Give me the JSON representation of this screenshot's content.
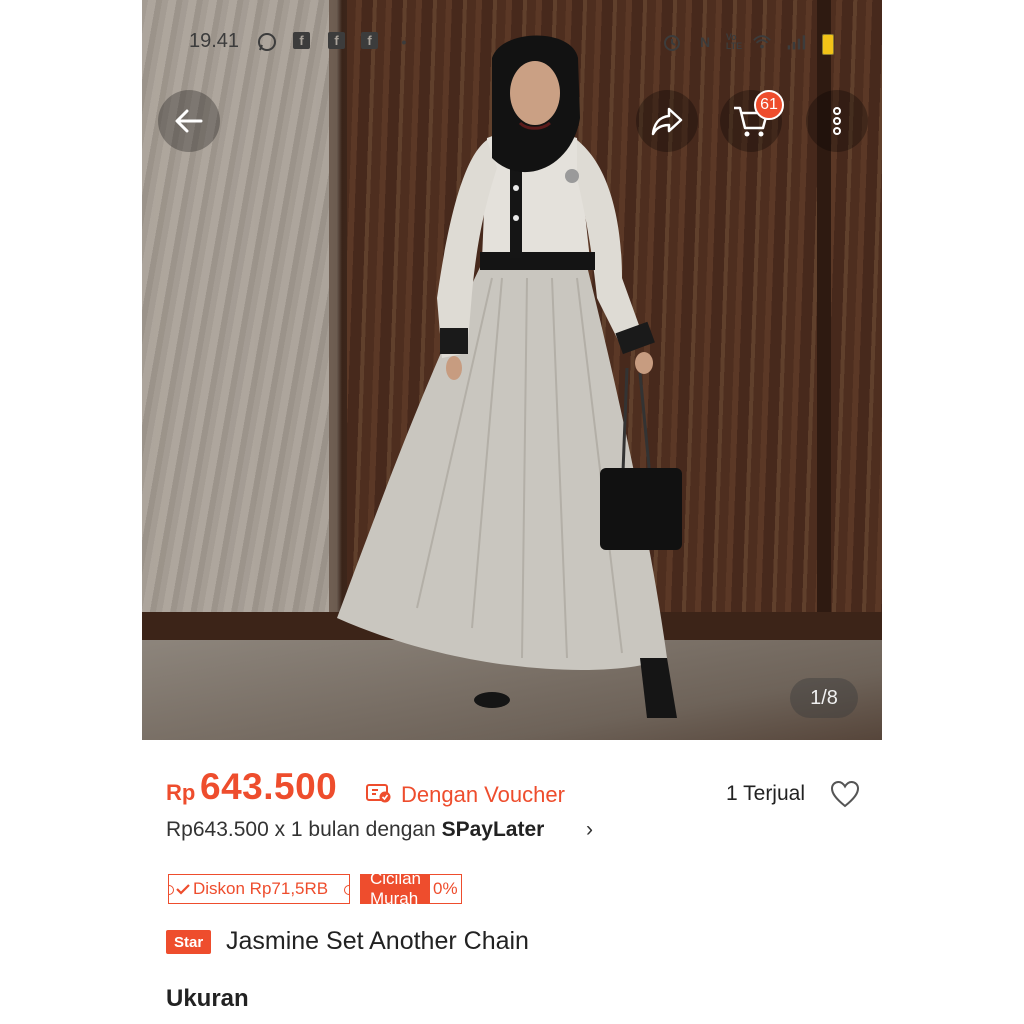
{
  "status_bar": {
    "time": "19.41",
    "icons": [
      "whatsapp-icon",
      "facebook-icon",
      "facebook-icon",
      "facebook-icon",
      "dot-icon",
      "alarm-icon",
      "nfc-icon",
      "volte-icon",
      "wifi-icon",
      "signal-icon",
      "battery-icon"
    ],
    "colors": {
      "battery": "#f2c318"
    }
  },
  "photo_nav": {
    "back_icon": "arrow-left-icon",
    "share_icon": "share-icon",
    "cart_icon": "cart-icon",
    "cart_count": "61",
    "more_icon": "more-vertical-icon",
    "page_counter": "1/8"
  },
  "product": {
    "price_currency": "Rp",
    "price_value": "643.500",
    "voucher_label": "Dengan Voucher",
    "sold_text": "1 Terjual",
    "paylater_prefix": "Rp643.500 x 1 bulan dengan ",
    "paylater_brand": "SPayLater",
    "paylater_chevron": "›",
    "discount_badge": "Diskon Rp71,5RB",
    "installment_badge": "Cicilan Murah",
    "installment_rate": "0%",
    "star_badge": "Star",
    "title": "Jasmine Set Another Chain",
    "size_heading": "Ukuran"
  },
  "colors": {
    "accent": "#ee4d2d",
    "text": "#222222"
  }
}
